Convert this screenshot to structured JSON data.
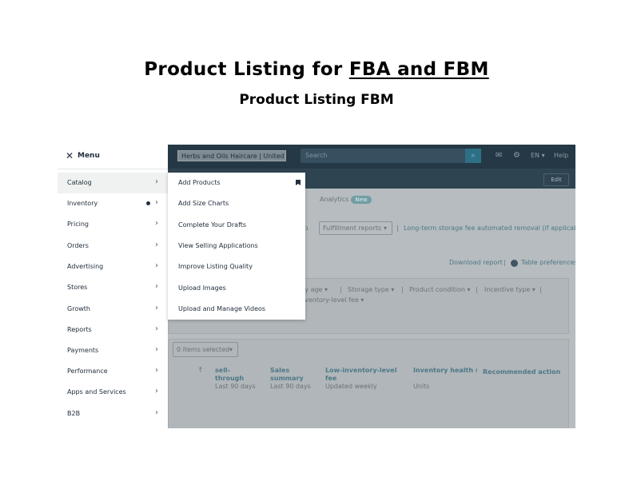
{
  "heading": {
    "title_prefix": "Product Listing for ",
    "title_underlined": "FBA and FBM",
    "subtitle": "Product Listing FBM"
  },
  "background": {
    "store_selector": "Herbs and Oils Haircare | United",
    "search_placeholder": "Search",
    "language": "EN",
    "language_caret": "▾",
    "help": "Help",
    "edit": "Edit",
    "analytics": "Analytics",
    "new_badge": "New",
    "go_to": "o to",
    "fulfillment_reports": "Fulfillment reports",
    "ltsf_text": "Long-term storage fee automated removal (if applicable)",
    "download_report": "Download report",
    "table_preferences": "Table preferences",
    "filters": [
      "ry age ▾",
      "Storage type ▾",
      "Product condition ▾",
      "Incentive type ▾"
    ],
    "filter_row2": "ventory-level fee ▾",
    "items_selected": "0 items selected",
    "columns": [
      {
        "title": "sell-through",
        "sub": "Last 90 days"
      },
      {
        "title": "Sales summary",
        "sub": "Last 90 days"
      },
      {
        "title": "Low-inventory-level fee",
        "sub": "Updated weekly"
      },
      {
        "title": "Inventory health sta recommendation",
        "sub": "Units"
      },
      {
        "title": "Recommended action",
        "sub": ""
      }
    ],
    "sort_arrow": "↑"
  },
  "menu": {
    "close_icon": "✕",
    "title": "Menu",
    "items": [
      {
        "label": "Catalog",
        "active": true
      },
      {
        "label": "Inventory",
        "dot": true
      },
      {
        "label": "Pricing"
      },
      {
        "label": "Orders"
      },
      {
        "label": "Advertising"
      },
      {
        "label": "Stores"
      },
      {
        "label": "Growth"
      },
      {
        "label": "Reports"
      },
      {
        "label": "Payments"
      },
      {
        "label": "Performance"
      },
      {
        "label": "Apps and Services"
      },
      {
        "label": "B2B"
      }
    ],
    "chevron": "›"
  },
  "submenu": {
    "items": [
      {
        "label": "Add Products",
        "bookmarked": true
      },
      {
        "label": "Add Size Charts"
      },
      {
        "label": "Complete Your Drafts"
      },
      {
        "label": "View Selling Applications"
      },
      {
        "label": "Improve Listing Quality"
      },
      {
        "label": "Upload Images"
      },
      {
        "label": "Upload and Manage Videos"
      }
    ]
  },
  "colors": {
    "nav_dark": "#253845",
    "dim_overlay": "#b6bcbf",
    "accent": "#2d7086"
  }
}
